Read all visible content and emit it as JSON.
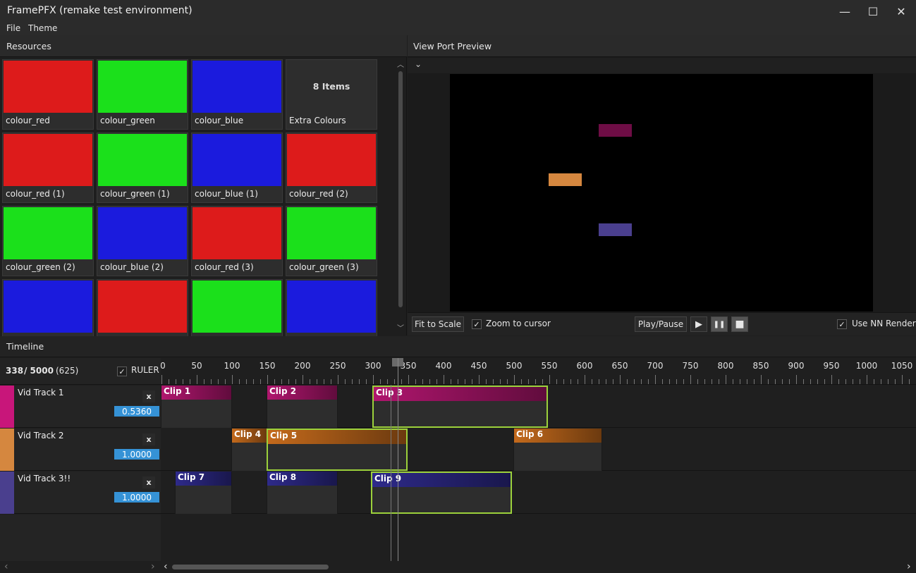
{
  "window": {
    "title": "FramePFX (remake test environment)",
    "minimize_icon": "—",
    "maximize_icon": "☐",
    "close_icon": "✕"
  },
  "menu": [
    "File",
    "Theme"
  ],
  "resources": {
    "title": "Resources",
    "items": [
      {
        "label": "colour_red",
        "color": "#dd1b1b"
      },
      {
        "label": "colour_green",
        "color": "#1be01b"
      },
      {
        "label": "colour_blue",
        "color": "#1b1bdd"
      },
      {
        "label": "Extra Colours",
        "group_text": "8 Items",
        "color": "#2d2d2d"
      },
      {
        "label": "colour_red (1)",
        "color": "#dd1b1b"
      },
      {
        "label": "colour_green (1)",
        "color": "#1be01b"
      },
      {
        "label": "colour_blue (1)",
        "color": "#1b1bdd"
      },
      {
        "label": "colour_red (2)",
        "color": "#dd1b1b"
      },
      {
        "label": "colour_green (2)",
        "color": "#1be01b"
      },
      {
        "label": "colour_blue (2)",
        "color": "#1b1bdd"
      },
      {
        "label": "colour_red (3)",
        "color": "#dd1b1b"
      },
      {
        "label": "colour_green (3)",
        "color": "#1be01b"
      },
      {
        "label": "",
        "color": "#1b1bdd"
      },
      {
        "label": "",
        "color": "#dd1b1b"
      },
      {
        "label": "",
        "color": "#1be01b"
      },
      {
        "label": "",
        "color": "#1b1bdd"
      }
    ]
  },
  "viewport": {
    "title": "View Port Preview",
    "collapse_icon": "⌄",
    "rects": [
      {
        "color": "#6e0d45"
      },
      {
        "color": "#d5873f"
      },
      {
        "color": "#4a3f8e"
      }
    ],
    "fit_to_scale": "Fit to Scale",
    "zoom_to_cursor": "Zoom to cursor",
    "zoom_checked": "✓",
    "play_pause": "Play/Pause",
    "play_icon": "▶",
    "pause_icon": "❚❚",
    "stop_icon": "■",
    "use_nn_render": "Use NN Render",
    "nn_checked": "✓"
  },
  "timeline": {
    "title": "Timeline",
    "frame_current": "338",
    "frame_total": "/ 5000",
    "frame_extra": "(625)",
    "ruler_label": "RULER",
    "ruler_checked": "✓",
    "ticks": [
      "0",
      "50",
      "100",
      "150",
      "200",
      "250",
      "300",
      "350",
      "400",
      "450",
      "500",
      "550",
      "600",
      "650",
      "700",
      "750",
      "800",
      "850",
      "900",
      "950",
      "1000",
      "1050"
    ],
    "tracks": [
      {
        "name": "Vid Track 1",
        "opacity": "0.5360",
        "color": "#c8167a",
        "close": "x"
      },
      {
        "name": "Vid Track 2",
        "opacity": "1.0000",
        "color": "#d5873f",
        "close": "x"
      },
      {
        "name": "Vid Track 3!!",
        "opacity": "1.0000",
        "color": "#4a3f8e",
        "close": "x"
      }
    ],
    "clips": [
      {
        "name": "Clip 1",
        "track": 0,
        "start": 0,
        "end": 100,
        "color": "#b0166e",
        "selected": false
      },
      {
        "name": "Clip 2",
        "track": 0,
        "start": 150,
        "end": 250,
        "color": "#b0166e",
        "selected": false
      },
      {
        "name": "Clip 3",
        "track": 0,
        "start": 300,
        "end": 548,
        "color": "#b0166e",
        "selected": true
      },
      {
        "name": "Clip 4",
        "track": 1,
        "start": 100,
        "end": 150,
        "color": "#c46a1c",
        "selected": false
      },
      {
        "name": "Clip 5",
        "track": 1,
        "start": 150,
        "end": 349,
        "color": "#c46a1c",
        "selected": true
      },
      {
        "name": "Clip 6",
        "track": 1,
        "start": 500,
        "end": 625,
        "color": "#c46a1c",
        "selected": false
      },
      {
        "name": "Clip 7",
        "track": 2,
        "start": 20,
        "end": 100,
        "color": "#2e2a8a",
        "selected": false
      },
      {
        "name": "Clip 8",
        "track": 2,
        "start": 150,
        "end": 250,
        "color": "#2e2a8a",
        "selected": false
      },
      {
        "name": "Clip 9",
        "track": 2,
        "start": 298,
        "end": 497,
        "color": "#2e2a8a",
        "selected": true
      }
    ],
    "playhead_frame": 338,
    "scroll_left_icon": "‹",
    "scroll_right_icon": "›"
  }
}
